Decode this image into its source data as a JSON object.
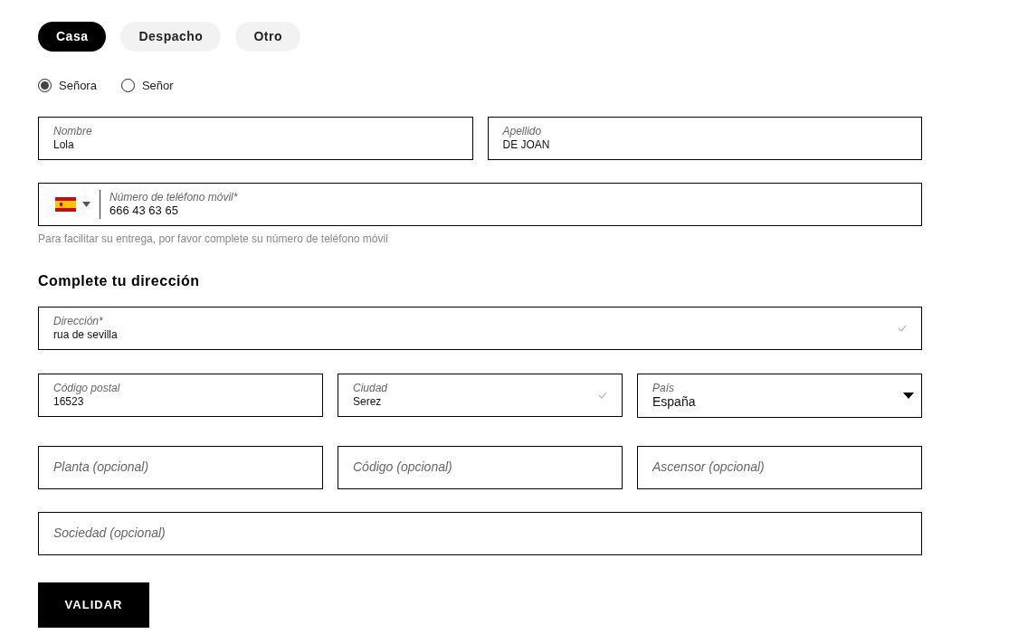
{
  "address_types": [
    {
      "label": "Casa",
      "selected": true
    },
    {
      "label": "Despacho",
      "selected": false
    },
    {
      "label": "Otro",
      "selected": false
    }
  ],
  "salutations": [
    {
      "label": "Señora",
      "selected": true
    },
    {
      "label": "Señor",
      "selected": false
    }
  ],
  "name_fields": [
    {
      "kind": "text",
      "label": "Nombre",
      "value": "Lola"
    },
    {
      "kind": "text",
      "label": "Apellido",
      "value": "DE JOAN"
    }
  ],
  "phone": {
    "label": "Número de teléfono móvil*",
    "value": "666 43 63 65",
    "hint": "Para facilitar su entrega, por favor complete su número de teléfono móvil"
  },
  "section_title": "Complete tu dirección",
  "address_rows": [
    [
      {
        "kind": "suggest",
        "label": "Dirección*",
        "value": "rua de sevilla"
      }
    ],
    [
      {
        "kind": "text",
        "label": "Código postal",
        "value": "16523"
      },
      {
        "kind": "suggest",
        "label": "Ciudad",
        "value": "Serez"
      },
      {
        "kind": "select",
        "label": "País",
        "value": "España"
      }
    ],
    [
      {
        "kind": "empty",
        "placeholder": "Planta (opcional)"
      },
      {
        "kind": "empty",
        "placeholder": "Código (opcional)"
      },
      {
        "kind": "empty",
        "placeholder": "Ascensor (opcional)"
      }
    ],
    [
      {
        "kind": "empty",
        "placeholder": "Sociedad (opcional)"
      }
    ]
  ],
  "submit_button": "VALIDAR"
}
